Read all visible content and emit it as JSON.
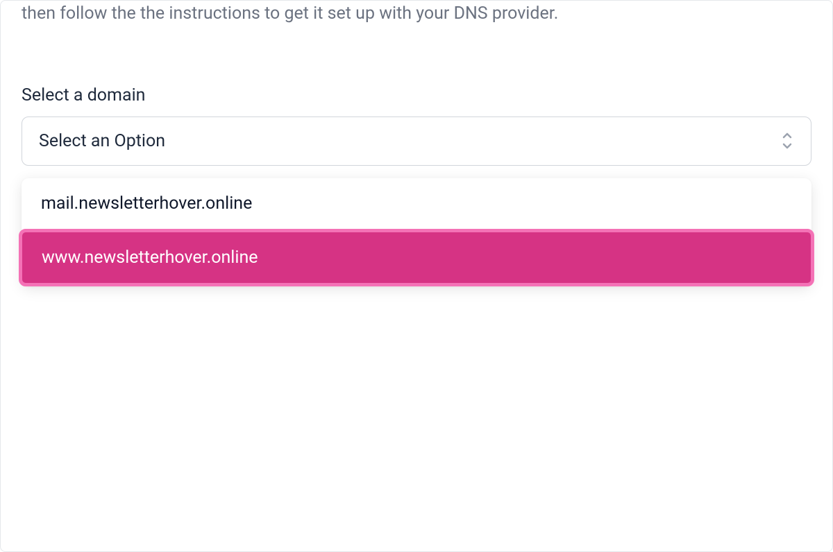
{
  "description": "then follow the the instructions to get it set up with your DNS provider.",
  "form": {
    "label": "Select a domain",
    "select": {
      "placeholder": "Select an Option",
      "options": [
        {
          "label": "mail.newsletterhover.online",
          "highlighted": false
        },
        {
          "label": "www.newsletterhover.online",
          "highlighted": true
        }
      ]
    }
  },
  "colors": {
    "highlight_bg": "#d63384",
    "highlight_border": "#f472b6",
    "text_muted": "#6b7280",
    "text_primary": "#1e293b"
  }
}
